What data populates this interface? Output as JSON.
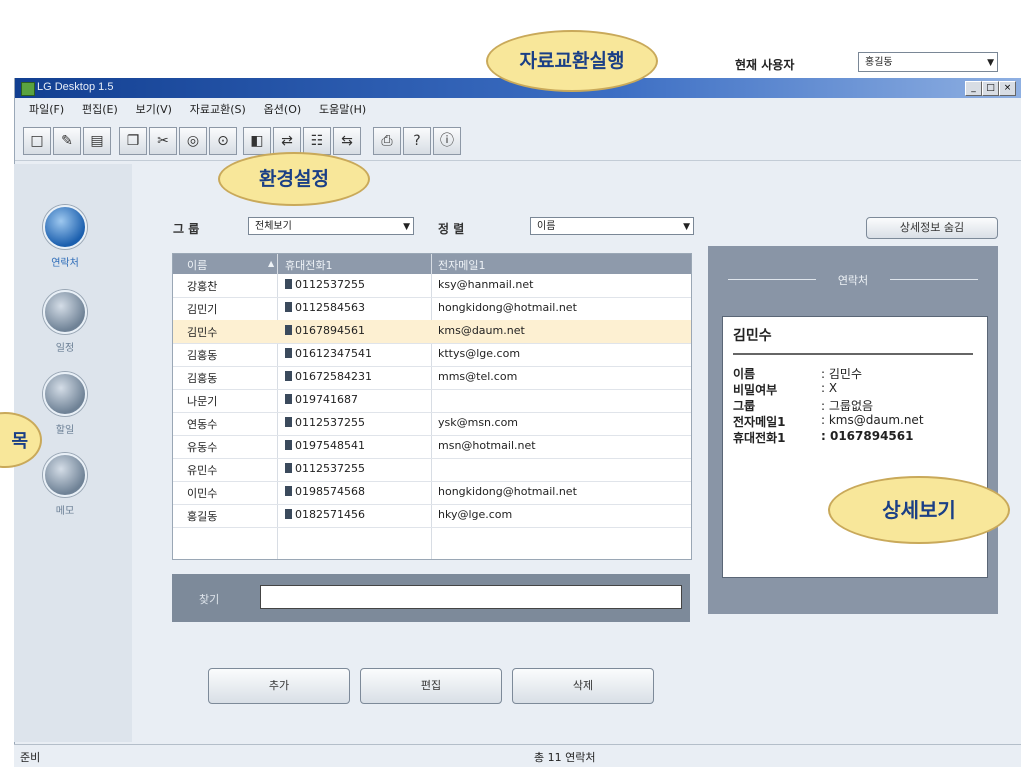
{
  "window": {
    "title": "LG Desktop 1.5",
    "min": "_",
    "max": "□",
    "close": "×"
  },
  "menu": [
    "파일(F)",
    "편집(E)",
    "보기(V)",
    "자료교환(S)",
    "옵션(O)",
    "도움말(H)"
  ],
  "toolbar": {
    "icons": [
      "new-icon",
      "edit-icon",
      "paste-icon",
      "copy-icon",
      "cut-icon",
      "print-preview-icon",
      "find-icon",
      "import-icon",
      "sync-icon",
      "contacts-icon",
      "exchange-icon",
      "print-icon",
      "help-icon",
      "about-icon"
    ],
    "current_user_label": "현재 사용자",
    "current_user_value": "홍길동"
  },
  "sidebar": [
    {
      "label": "연락처",
      "active": true
    },
    {
      "label": "일정",
      "active": false
    },
    {
      "label": "할일",
      "active": false
    },
    {
      "label": "메모",
      "active": false
    }
  ],
  "filters": {
    "group_label": "그 룹",
    "group_value": "전체보기",
    "sort_label": "정 렬",
    "sort_value": "이름",
    "detail_toggle": "상세정보 숨김"
  },
  "table": {
    "headers": [
      "이름",
      "휴대전화1",
      "전자메일1"
    ],
    "rows": [
      {
        "name": "강홍찬",
        "phone": "0112537255",
        "email": "ksy@hanmail.net"
      },
      {
        "name": "김민기",
        "phone": "0112584563",
        "email": "hongkidong@hotmail.net"
      },
      {
        "name": "김민수",
        "phone": "0167894561",
        "email": "kms@daum.net"
      },
      {
        "name": "김홍동",
        "phone": "01612347541",
        "email": "kttys@lge.com"
      },
      {
        "name": "김홍동",
        "phone": "01672584231",
        "email": "mms@tel.com"
      },
      {
        "name": "나문기",
        "phone": "019741687",
        "email": ""
      },
      {
        "name": "연동수",
        "phone": "0112537255",
        "email": "ysk@msn.com"
      },
      {
        "name": "유동수",
        "phone": "0197548541",
        "email": "msn@hotmail.net"
      },
      {
        "name": "유민수",
        "phone": "0112537255",
        "email": ""
      },
      {
        "name": "이민수",
        "phone": "0198574568",
        "email": "hongkidong@hotmail.net"
      },
      {
        "name": "홍길동",
        "phone": "0182571456",
        "email": "hky@lge.com"
      }
    ],
    "selected_index": 2
  },
  "search": {
    "label": "찾기",
    "value": ""
  },
  "detail": {
    "title": "연락처",
    "name": "김민수",
    "fields": [
      {
        "key": "이름",
        "value": ": 김민수"
      },
      {
        "key": "비밀여부",
        "value": ": X"
      },
      {
        "key": "그룹",
        "value": ": 그룹없음"
      },
      {
        "key": "전자메일1",
        "value": ": kms@daum.net"
      },
      {
        "key": "휴대전화1",
        "value": ": 0167894561"
      }
    ]
  },
  "actions": {
    "add": "추가",
    "edit": "편집",
    "delete": "삭제"
  },
  "status": {
    "left": "준비",
    "count": "총 11 연락처"
  },
  "callouts": {
    "exchange": "자료교환실행",
    "settings": "환경설정",
    "detail_view": "상세보기",
    "list": "목"
  }
}
